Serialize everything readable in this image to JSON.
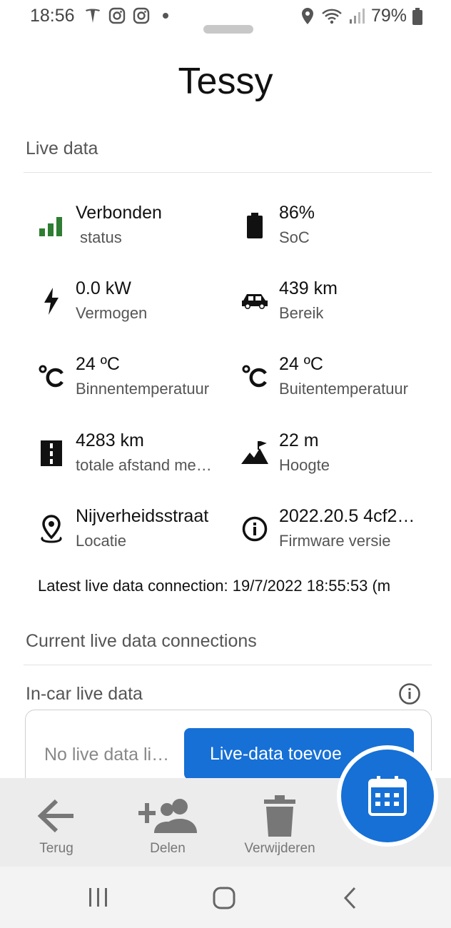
{
  "status_bar": {
    "time": "18:56",
    "battery": "79%",
    "icons_left": [
      "tesla-icon",
      "instagram-icon",
      "instagram-icon",
      "dot-icon"
    ],
    "icons_right": [
      "location-icon",
      "wifi-icon",
      "signal-icon",
      "battery-icon"
    ]
  },
  "title": "Tessy",
  "live_data": {
    "heading": "Live data",
    "items": [
      {
        "value": "Verbonden",
        "label": "status",
        "icon": "signal-bars-icon"
      },
      {
        "value": "86%",
        "label": "SoC",
        "icon": "battery-icon"
      },
      {
        "value": "0.0 kW",
        "label": "Vermogen",
        "icon": "lightning-icon"
      },
      {
        "value": "439 km",
        "label": "Bereik",
        "icon": "car-icon"
      },
      {
        "value": "24 ºC",
        "label": "Binnentemperatuur",
        "icon": "celsius-icon"
      },
      {
        "value": "24 ºC",
        "label": "Buitentemperatuur",
        "icon": "celsius-icon"
      },
      {
        "value": "4283 km",
        "label": "totale afstand me…",
        "icon": "road-icon"
      },
      {
        "value": "22 m",
        "label": "Hoogte",
        "icon": "mountain-flag-icon"
      },
      {
        "value": "Nijverheidsstraat",
        "label": "Locatie",
        "icon": "location-pin-icon"
      },
      {
        "value": "2022.20.5 4cf2…",
        "label": "Firmware versie",
        "icon": "info-icon"
      }
    ],
    "latest_connection": "Latest live data connection: 19/7/2022 18:55:53 (m"
  },
  "connections": {
    "heading": "Current live data connections",
    "incar_heading": "In-car live data",
    "empty_text": "No live data li…",
    "add_button": "Live-data toevoe"
  },
  "bottom_bar": {
    "back": "Terug",
    "share": "Delen",
    "delete": "Verwijderen"
  },
  "colors": {
    "accent": "#1670d6",
    "signal_green": "#2e7d32"
  }
}
